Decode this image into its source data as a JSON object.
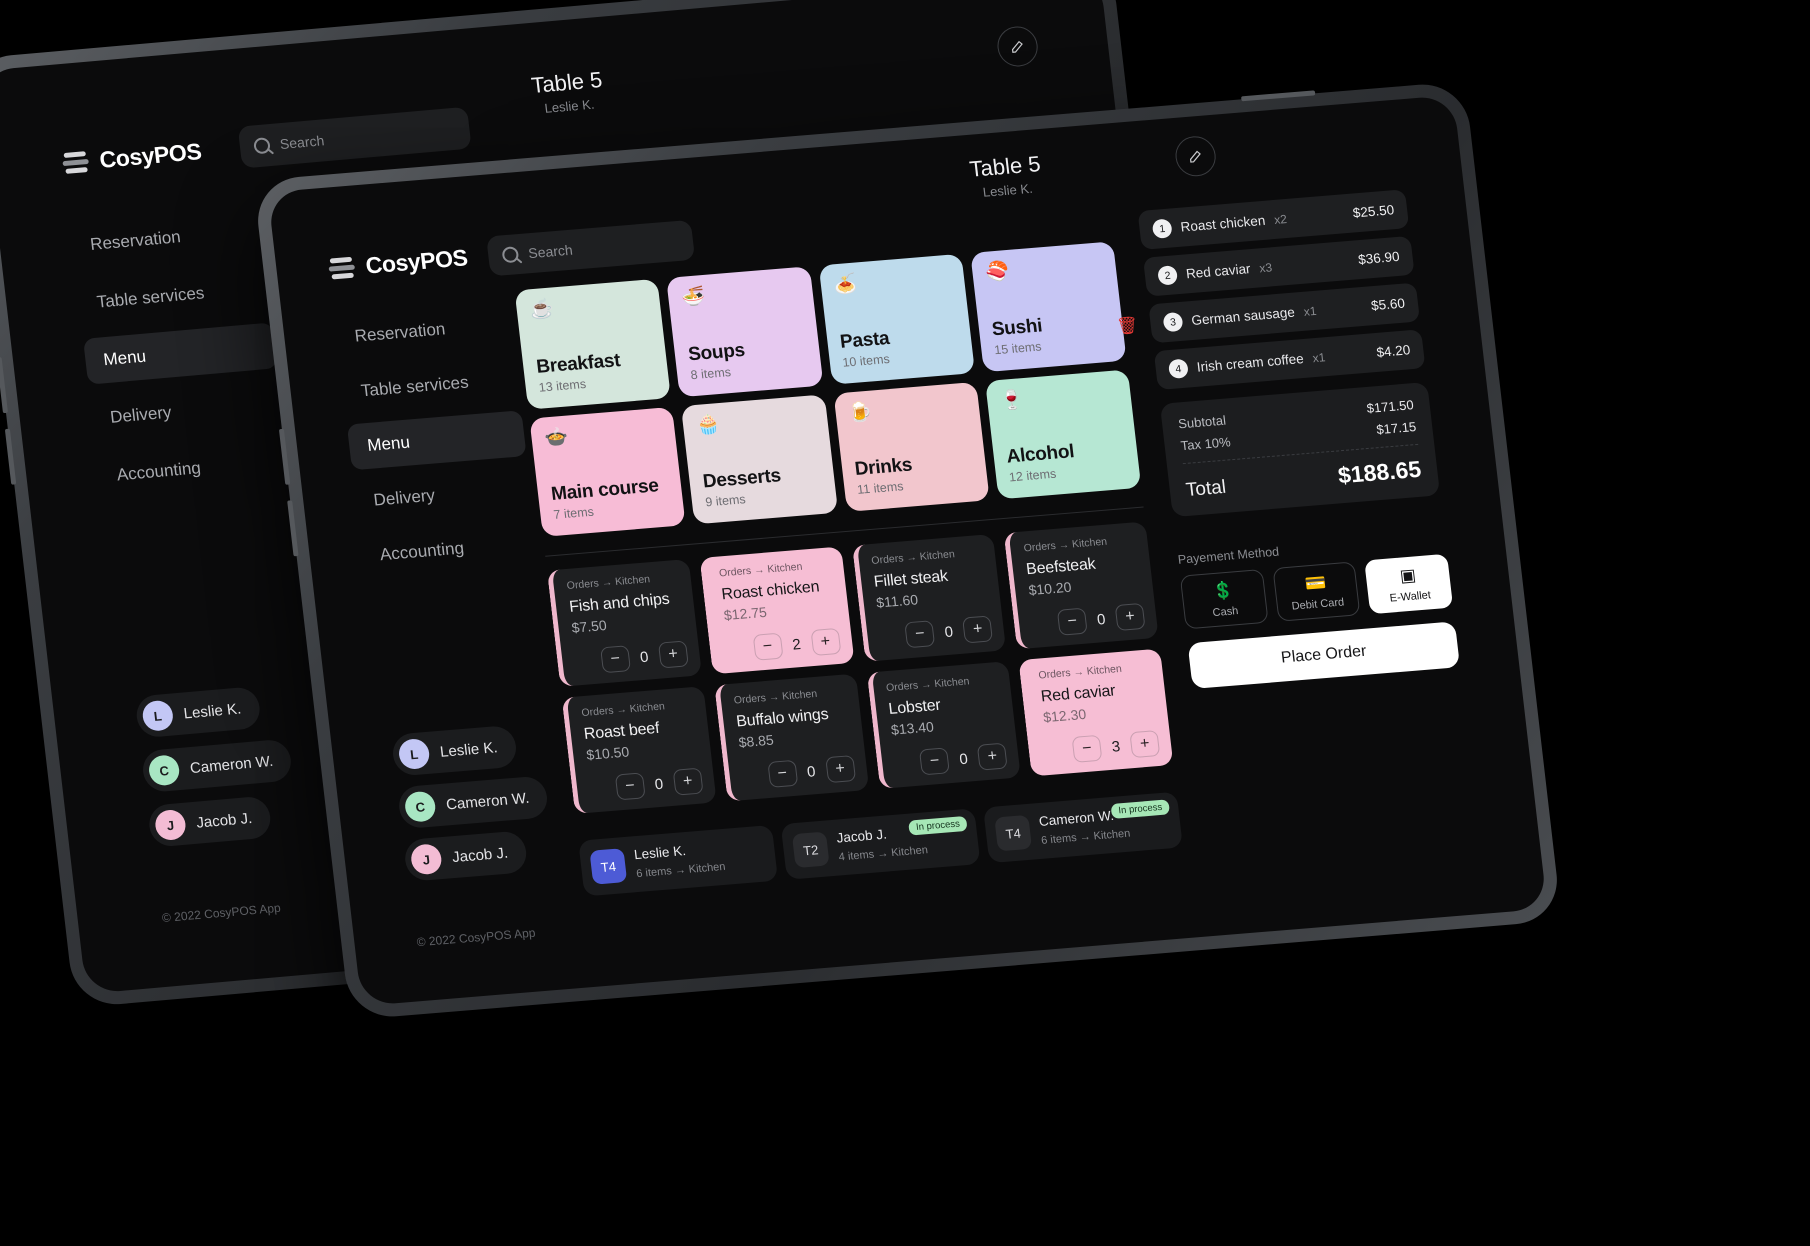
{
  "brand": {
    "name": "CosyPOS"
  },
  "search": {
    "placeholder": "Search",
    "icon": "search-icon"
  },
  "nav": {
    "items": [
      {
        "label": "Reservation",
        "active": false
      },
      {
        "label": "Table services",
        "active": false
      },
      {
        "label": "Menu",
        "active": true
      },
      {
        "label": "Delivery",
        "active": false
      },
      {
        "label": "Accounting",
        "active": false
      }
    ]
  },
  "people": [
    {
      "initial": "L",
      "name": "Leslie K.",
      "color": "#c3c7f5"
    },
    {
      "initial": "C",
      "name": "Cameron W.",
      "color": "#a8e6c3"
    },
    {
      "initial": "J",
      "name": "Jacob J.",
      "color": "#f3bcd4"
    }
  ],
  "footer": {
    "copyright": "© 2022 CosyPOS App"
  },
  "header": {
    "table": "Table 5",
    "waiter": "Leslie K.",
    "edit_icon": "pencil-icon"
  },
  "categories": [
    {
      "name": "Breakfast",
      "count": "13 items",
      "icon": "☕",
      "color": "#d4e6dc"
    },
    {
      "name": "Soups",
      "count": "8 items",
      "icon": "🍜",
      "color": "#e7c9f0"
    },
    {
      "name": "Pasta",
      "count": "10 items",
      "icon": "🍝",
      "color": "#bedbec"
    },
    {
      "name": "Sushi",
      "count": "15 items",
      "icon": "🍣",
      "color": "#c7c6f4"
    },
    {
      "name": "Main course",
      "count": "7 items",
      "icon": "🍲",
      "color": "#f7bcd6"
    },
    {
      "name": "Desserts",
      "count": "9 items",
      "icon": "🧁",
      "color": "#e6dade"
    },
    {
      "name": "Drinks",
      "count": "11 items",
      "icon": "🍺",
      "color": "#f2c6cd"
    },
    {
      "name": "Alcohol",
      "count": "12 items",
      "icon": "🍷",
      "color": "#b6e7d3"
    }
  ],
  "products": [
    {
      "kitchen": "Orders → Kitchen",
      "name": "Fish and chips",
      "price": "$7.50",
      "qty": "0",
      "selected": false
    },
    {
      "kitchen": "Orders → Kitchen",
      "name": "Roast chicken",
      "price": "$12.75",
      "qty": "2",
      "selected": true
    },
    {
      "kitchen": "Orders → Kitchen",
      "name": "Fillet steak",
      "price": "$11.60",
      "qty": "0",
      "selected": false
    },
    {
      "kitchen": "Orders → Kitchen",
      "name": "Beefsteak",
      "price": "$10.20",
      "qty": "0",
      "selected": false
    },
    {
      "kitchen": "Orders → Kitchen",
      "name": "Roast beef",
      "price": "$10.50",
      "qty": "0",
      "selected": false
    },
    {
      "kitchen": "Orders → Kitchen",
      "name": "Buffalo wings",
      "price": "$8.85",
      "qty": "0",
      "selected": false
    },
    {
      "kitchen": "Orders → Kitchen",
      "name": "Lobster",
      "price": "$13.40",
      "qty": "0",
      "selected": false
    },
    {
      "kitchen": "Orders → Kitchen",
      "name": "Red caviar",
      "price": "$12.30",
      "qty": "3",
      "selected": true
    }
  ],
  "order": {
    "items": [
      {
        "num": "1",
        "name": "Roast chicken",
        "qty": "x2",
        "price": "$25.50",
        "deletable": false
      },
      {
        "num": "2",
        "name": "Red caviar",
        "qty": "x3",
        "price": "$36.90",
        "deletable": false
      },
      {
        "num": "3",
        "name": "German sausage",
        "qty": "x1",
        "price": "$5.60",
        "deletable": true
      },
      {
        "num": "4",
        "name": "Irish cream coffee",
        "qty": "x1",
        "price": "$4.20",
        "deletable": false
      }
    ],
    "subtotal_label": "Subtotal",
    "subtotal_value": "$171.50",
    "tax_label": "Tax 10%",
    "tax_value": "$17.15",
    "total_label": "Total",
    "total_value": "$188.65",
    "payment_label": "Payement Method",
    "payment_methods": [
      {
        "label": "Cash",
        "icon": "💲",
        "active": false
      },
      {
        "label": "Debit Card",
        "icon": "💳",
        "active": false
      },
      {
        "label": "E-Wallet",
        "icon": "▣",
        "active": true
      }
    ],
    "place_order": "Place Order"
  },
  "table_tabs": [
    {
      "code": "T4",
      "name": "Leslie K.",
      "meta": "6 items → Kitchen",
      "status": "",
      "active": true
    },
    {
      "code": "T2",
      "name": "Jacob J.",
      "meta": "4 items → Kitchen",
      "status": "In process",
      "active": false
    },
    {
      "code": "T4",
      "name": "Cameron W.",
      "meta": "6 items → Kitchen",
      "status": "In process",
      "active": false
    }
  ],
  "colors": {
    "accent": "#4d5bd6",
    "highlight_pink": "#f6bed4",
    "status_green": "#a6e7b6"
  }
}
